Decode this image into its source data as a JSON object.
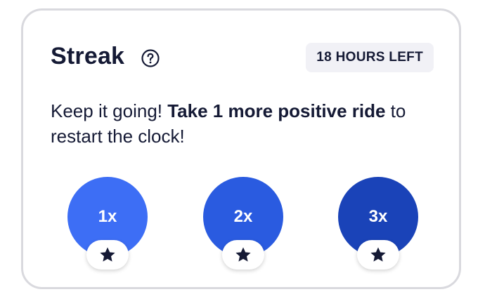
{
  "streak": {
    "title": "Streak",
    "help_icon": "question-circle-icon",
    "time_left": "18 HOURS LEFT",
    "message_plain_1": "Keep it going! ",
    "message_bold": "Take 1 more positive ride",
    "message_plain_2": " to restart the clock!",
    "tiers": [
      {
        "label": "1x",
        "color": "#3d6ef5",
        "icon": "star-icon"
      },
      {
        "label": "2x",
        "color": "#2a5be0",
        "icon": "star-icon"
      },
      {
        "label": "3x",
        "color": "#1a43b8",
        "icon": "star-icon"
      }
    ]
  }
}
